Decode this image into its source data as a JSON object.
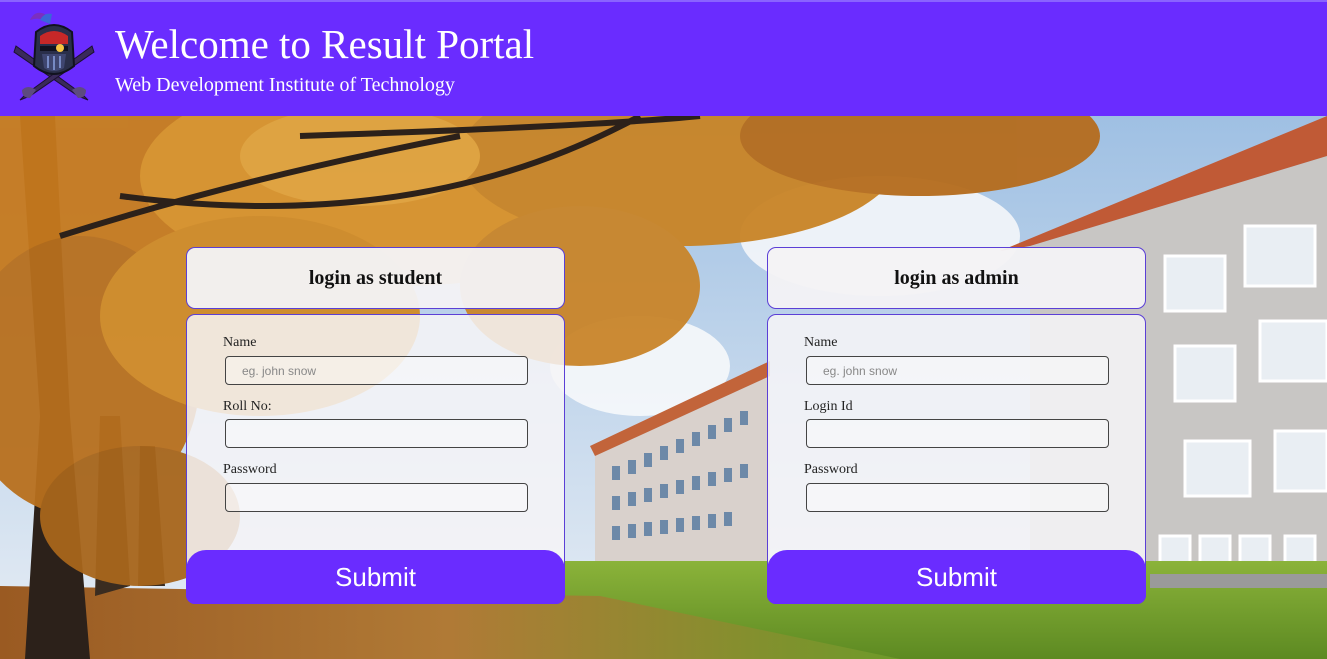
{
  "header": {
    "title": "Welcome to Result Portal",
    "subtitle": "Web Development Institute of Technology",
    "logo_icon": "knight-helmet-crossed-swords-icon",
    "bg_color": "#6a2cff"
  },
  "student_form": {
    "heading": "login as student",
    "name_label": "Name",
    "name_placeholder": "eg. john snow",
    "roll_label": "Roll No:",
    "password_label": "Password",
    "submit_label": "Submit"
  },
  "admin_form": {
    "heading": "login as admin",
    "name_label": "Name",
    "name_placeholder": "eg. john snow",
    "login_label": "Login Id",
    "password_label": "Password",
    "submit_label": "Submit"
  },
  "colors": {
    "accent": "#6a2cff",
    "card_border": "#5b3fd6"
  }
}
